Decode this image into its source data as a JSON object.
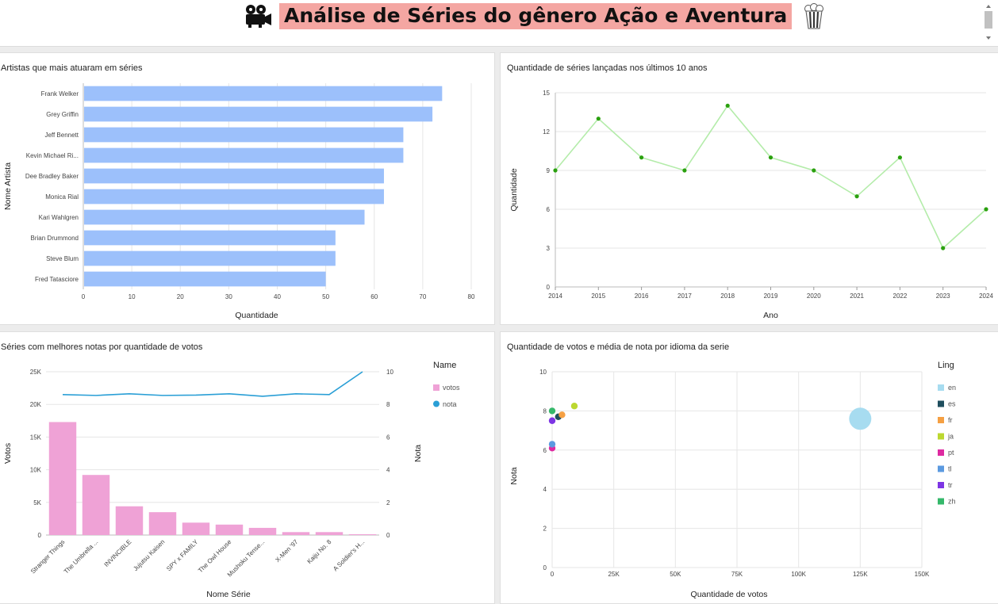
{
  "header": {
    "title": "Análise de Séries do gênero Ação e Aventura",
    "left_icon": "film-camera-icon",
    "right_icon": "popcorn-icon"
  },
  "colors": {
    "title_bg": "#f4a6a2",
    "bar_blue": "#9cc0fb",
    "line_green": "#b4ecaa",
    "point_green": "#2aa00e",
    "votes_pink": "#efa2d6",
    "nota_blue": "#2a9fd6"
  },
  "chart_data": [
    {
      "id": "artists",
      "title": "Artistas que mais atuaram em séries",
      "type": "bar",
      "orientation": "horizontal",
      "xlabel": "Quantidade",
      "ylabel": "Nome Artista",
      "xlim": [
        0,
        80
      ],
      "xticks": [
        0,
        10,
        20,
        30,
        40,
        50,
        60,
        70,
        80
      ],
      "categories": [
        "Frank Welker",
        "Grey Griffin",
        "Jeff Bennett",
        "Kevin Michael Ri...",
        "Dee Bradley Baker",
        "Monica Rial",
        "Kari Wahlgren",
        "Brian Drummond",
        "Steve Blum",
        "Fred Tatasciore"
      ],
      "values": [
        74,
        72,
        66,
        66,
        62,
        62,
        58,
        52,
        52,
        50
      ],
      "grid": true
    },
    {
      "id": "releases",
      "title": "Quantidade de séries lançadas nos últimos 10 anos",
      "type": "line",
      "xlabel": "Ano",
      "ylabel": "Quantidade",
      "ylim": [
        0,
        15
      ],
      "yticks": [
        0,
        3,
        6,
        9,
        12,
        15
      ],
      "x": [
        "2014",
        "2015",
        "2016",
        "2017",
        "2018",
        "2019",
        "2020",
        "2021",
        "2022",
        "2023",
        "2024"
      ],
      "values": [
        9,
        13,
        10,
        9,
        14,
        10,
        9,
        7,
        10,
        3,
        6
      ],
      "grid": true
    },
    {
      "id": "top_series",
      "title": "Séries com melhores notas por quantidade de votos",
      "type": "bar",
      "xlabel": "Nome Série",
      "ylabel": "Votos",
      "y2label": "Nota",
      "legend_title": "Name",
      "legend_position": "right",
      "ylim": [
        0,
        25000
      ],
      "yticks": [
        "0",
        "5K",
        "10K",
        "15K",
        "20K",
        "25K"
      ],
      "y2lim": [
        0,
        10
      ],
      "y2ticks": [
        "0",
        "2",
        "4",
        "6",
        "8",
        "10"
      ],
      "categories": [
        "Stranger Things",
        "The Umbrella ...",
        "INVINCIBLE",
        "Jujutsu Kaisen",
        "SPY x FAMILY",
        "The Owl House",
        "Mushoku Tense...",
        "X-Men '97",
        "Kaiju No. 8",
        "A Soldier's H..."
      ],
      "series": [
        {
          "name": "votos",
          "type": "bar",
          "axis": "left",
          "values": [
            17300,
            9200,
            4400,
            3500,
            1900,
            1600,
            1100,
            450,
            450,
            120
          ]
        },
        {
          "name": "nota",
          "type": "line",
          "axis": "right",
          "values": [
            8.6,
            8.55,
            8.65,
            8.55,
            8.57,
            8.65,
            8.5,
            8.65,
            8.6,
            10.0
          ]
        }
      ],
      "grid": true
    },
    {
      "id": "languages",
      "title": "Quantidade de votos e média de nota por idioma da serie",
      "type": "scatter",
      "xlabel": "Quantidade de votos",
      "ylabel": "Nota",
      "legend_title": "Ling",
      "legend_position": "right",
      "xlim": [
        0,
        150000
      ],
      "xticks": [
        "0",
        "25K",
        "50K",
        "75K",
        "100K",
        "125K",
        "150K"
      ],
      "ylim": [
        0,
        10
      ],
      "yticks": [
        "0",
        "2",
        "4",
        "6",
        "8",
        "10"
      ],
      "points": [
        {
          "name": "en",
          "x": 125000,
          "y": 7.6,
          "color": "#a7dcf0",
          "size": 3
        },
        {
          "name": "es",
          "x": 2500,
          "y": 7.7,
          "color": "#1f4e5e",
          "size": 1
        },
        {
          "name": "fr",
          "x": 4000,
          "y": 7.8,
          "color": "#f5a043",
          "size": 1
        },
        {
          "name": "ja",
          "x": 9000,
          "y": 8.25,
          "color": "#bcd830",
          "size": 1
        },
        {
          "name": "pt",
          "x": 0,
          "y": 6.1,
          "color": "#de2aa1",
          "size": 1
        },
        {
          "name": "tl",
          "x": 0,
          "y": 6.3,
          "color": "#5b9ae0",
          "size": 1
        },
        {
          "name": "tr",
          "x": 0,
          "y": 7.5,
          "color": "#7d35e4",
          "size": 1
        },
        {
          "name": "zh",
          "x": 0,
          "y": 8.0,
          "color": "#35b86a",
          "size": 1
        }
      ],
      "grid": true
    }
  ]
}
